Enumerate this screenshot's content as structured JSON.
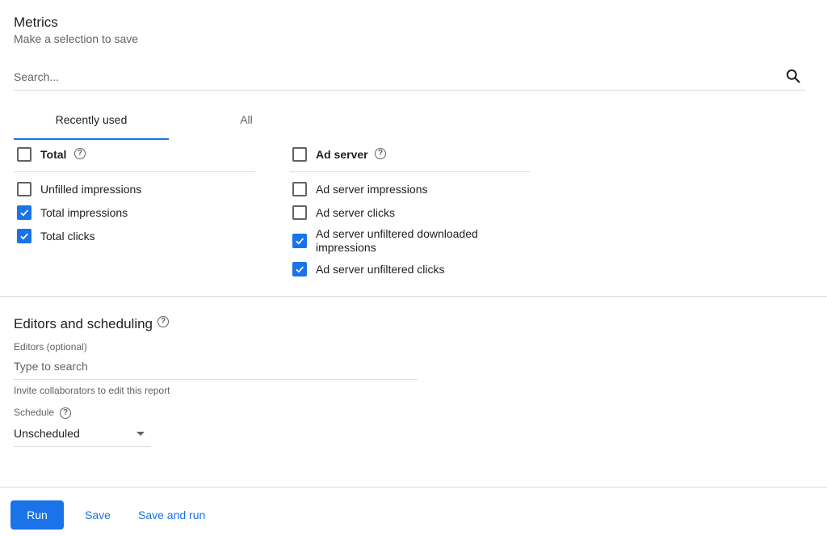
{
  "metrics": {
    "title": "Metrics",
    "subtitle": "Make a selection to save",
    "search_placeholder": "Search...",
    "tabs": [
      {
        "label": "Recently used",
        "active": true
      },
      {
        "label": "All",
        "active": false
      }
    ],
    "groups": [
      {
        "label": "Total",
        "checked": false,
        "items": [
          {
            "label": "Unfilled impressions",
            "checked": false
          },
          {
            "label": "Total impressions",
            "checked": true
          },
          {
            "label": "Total clicks",
            "checked": true
          }
        ]
      },
      {
        "label": "Ad server",
        "checked": false,
        "items": [
          {
            "label": "Ad server impressions",
            "checked": false
          },
          {
            "label": "Ad server clicks",
            "checked": false
          },
          {
            "label": "Ad server unfiltered downloaded impressions",
            "checked": true
          },
          {
            "label": "Ad server unfiltered clicks",
            "checked": true
          }
        ]
      }
    ]
  },
  "editors": {
    "title": "Editors and scheduling",
    "editors_label": "Editors (optional)",
    "editors_placeholder": "Type to search",
    "editors_hint": "Invite collaborators to edit this report",
    "schedule_label": "Schedule",
    "schedule_value": "Unscheduled"
  },
  "footer": {
    "run_label": "Run",
    "save_label": "Save",
    "save_and_run_label": "Save and run"
  },
  "colors": {
    "accent": "#1a73e8",
    "divider": "#dadce0"
  }
}
